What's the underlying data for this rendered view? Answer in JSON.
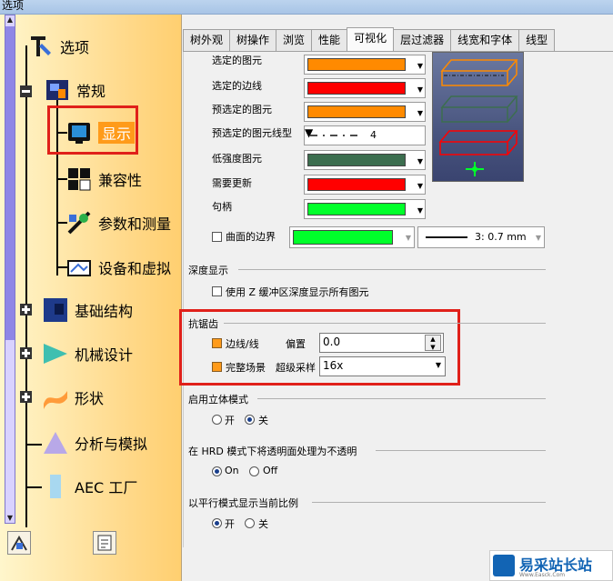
{
  "window": {
    "title": "选项"
  },
  "tree": {
    "items": [
      {
        "label": "选项",
        "icon": "options-tool-icon"
      },
      {
        "label": "常规",
        "icon": "general-icon"
      },
      {
        "label": "显示",
        "icon": "display-monitor-icon",
        "selected": true
      },
      {
        "label": "兼容性",
        "icon": "compatibility-icon"
      },
      {
        "label": "参数和测量",
        "icon": "parameters-icon"
      },
      {
        "label": "设备和虚拟",
        "icon": "devices-icon"
      },
      {
        "label": "基础结构",
        "icon": "infrastructure-icon"
      },
      {
        "label": "机械设计",
        "icon": "mechanical-design-icon"
      },
      {
        "label": "形状",
        "icon": "shape-icon"
      },
      {
        "label": "分析与模拟",
        "icon": "analysis-icon"
      },
      {
        "label": "AEC 工厂",
        "icon": "aec-plant-icon"
      }
    ]
  },
  "tabs": [
    {
      "label": "树外观"
    },
    {
      "label": "树操作"
    },
    {
      "label": "浏览"
    },
    {
      "label": "性能"
    },
    {
      "label": "可视化",
      "active": true
    },
    {
      "label": "层过滤器"
    },
    {
      "label": "线宽和字体"
    },
    {
      "label": "线型"
    }
  ],
  "colors": {
    "orange": "#ff8a00",
    "red": "#ff0000",
    "dark_green": "#3c6e4f",
    "green": "#00ff2a",
    "highlight_red": "#e0201a"
  },
  "visual": {
    "rows": [
      {
        "label": "选定的图元",
        "color": "#ff8a00"
      },
      {
        "label": "选定的边线",
        "color": "#ff0000"
      },
      {
        "label": "预选定的图元",
        "color": "#ff8a00"
      },
      {
        "label": "预选定的图元线型",
        "linestyle": "4"
      },
      {
        "label": "低强度图元",
        "color": "#3c6e4f"
      },
      {
        "label": "需要更新",
        "color": "#ff0000"
      },
      {
        "label": "句柄",
        "color": "#00ff2a"
      }
    ],
    "surface_boundary": {
      "label": "曲面的边界",
      "color": "#00ff2a",
      "thickness": "3: 0.7 mm"
    }
  },
  "depth": {
    "title": "深度显示",
    "option": "使用 Z 缓冲区深度显示所有图元"
  },
  "antialias": {
    "title": "抗锯齿",
    "edges_label": "边线/线",
    "offset_label": "偏置",
    "offset_value": "0.0",
    "fullscene_label": "完整场景",
    "supersample_label": "超级采样",
    "supersample_value": "16x"
  },
  "stereo": {
    "title": "启用立体模式",
    "on": "开",
    "off": "关"
  },
  "hrd": {
    "title": "在 HRD 模式下将透明面处理为不透明",
    "on": "On",
    "off": "Off"
  },
  "parallel": {
    "title": "以平行模式显示当前比例",
    "on": "开",
    "off": "关"
  },
  "watermark": {
    "text": "易采站长站",
    "sub": "Www.Easck.Com"
  }
}
